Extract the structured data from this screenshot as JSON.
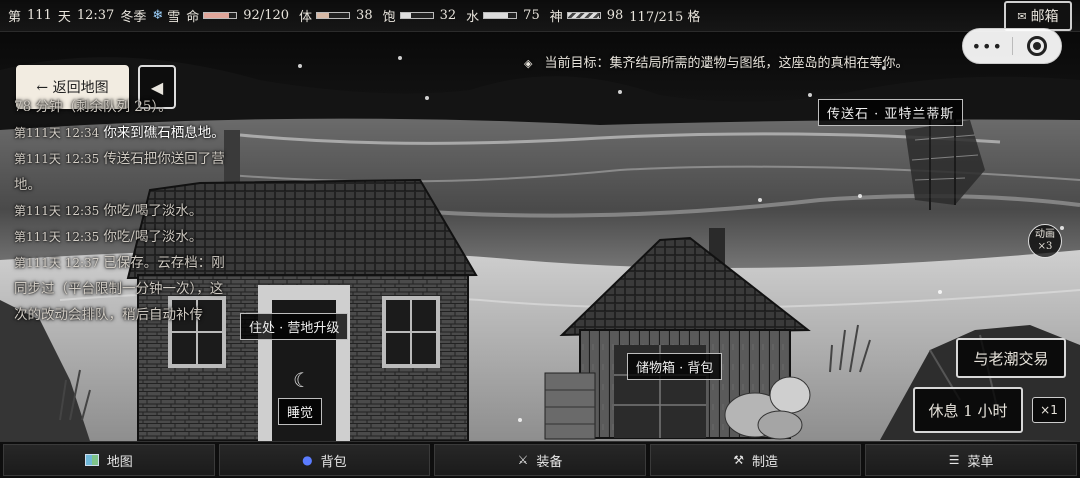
{
  "status": {
    "day_prefix": "第",
    "day": "111",
    "day_suffix": "天",
    "time": "12:37",
    "season": "冬季",
    "weather_icon": "snowflake-icon",
    "weather": "雪",
    "hp_label": "命",
    "hp": "92/120",
    "hp_ratio": 0.77,
    "stamina_label": "体",
    "stamina": "38",
    "stamina_ratio": 0.38,
    "hunger_label": "饱",
    "hunger": "32",
    "hunger_ratio": 0.32,
    "water_label": "水",
    "water": "75",
    "water_ratio": 0.75,
    "mind_label": "神",
    "mind": "98",
    "mind_ratio": 0.98,
    "weight": "117/215 格"
  },
  "mailbox": {
    "icon": "envelope-icon",
    "label": "邮箱"
  },
  "capsule": {
    "more": "•••"
  },
  "nav_top": {
    "back_map": "← 返回地图",
    "back_arrow": "◀"
  },
  "objective": {
    "marker": "◈",
    "text": "当前目标：集齐结局所需的遗物与图纸，这座岛的真相在等你。"
  },
  "log": [
    {
      "stamp": "",
      "msg": "78 分钟（剩余队列 25）。",
      "hl": false
    },
    {
      "stamp": "第111天 12:34",
      "msg": "你来到礁石栖息地。",
      "hl": true
    },
    {
      "stamp": "第111天 12:35",
      "msg": "传送石把你送回了营地。",
      "hl": false
    },
    {
      "stamp": "第111天 12:35",
      "msg": "你吃/喝了淡水。",
      "hl": false
    },
    {
      "stamp": "第111天 12:35",
      "msg": "你吃/喝了淡水。",
      "hl": false
    },
    {
      "stamp": "第111天 12:37",
      "msg": "已保存。云存档：刚同步过（平台限制一分钟一次），这次的改动会排队，稍后自动补传",
      "hl": false
    }
  ],
  "hotspots": {
    "teleport": "传送石 · 亚特兰蒂斯",
    "residence": "住处 · 营地升级",
    "storage": "储物箱 · 背包",
    "sleep": "睡觉",
    "moon_icon": "☾"
  },
  "speed": {
    "label": "动画",
    "value": "×3"
  },
  "actions": {
    "trade": "与老潮交易",
    "rest": "休息 1 小时",
    "multiplier": "×1"
  },
  "bottom_nav": [
    {
      "icon": "map-icon",
      "label": "地图"
    },
    {
      "icon": "backpack-icon",
      "label": "背包"
    },
    {
      "icon": "swords-icon",
      "label": "装备",
      "glyph": "⚔"
    },
    {
      "icon": "hammer-icon",
      "label": "制造",
      "glyph": "⚒"
    },
    {
      "icon": "menu-icon",
      "label": "菜单",
      "glyph": "☰"
    }
  ]
}
